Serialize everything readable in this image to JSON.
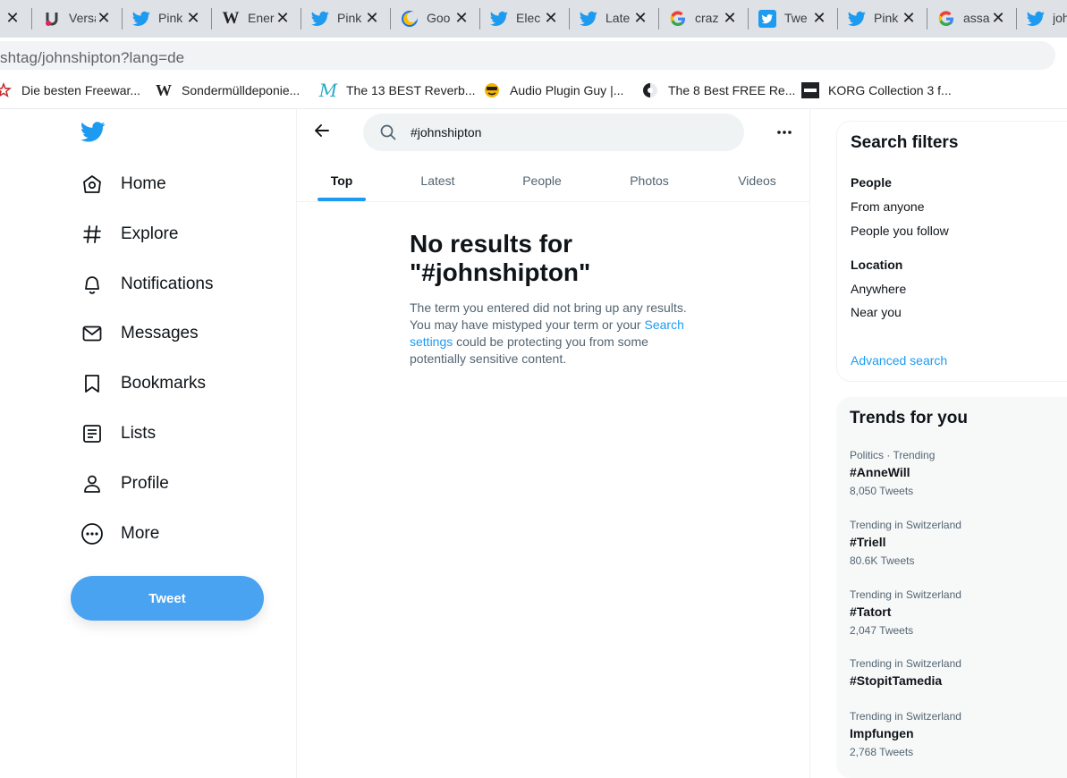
{
  "browser": {
    "tabs": [
      {
        "icon": "close-icon",
        "title": ""
      },
      {
        "icon": "u-logo-icon",
        "title": "Versa"
      },
      {
        "icon": "twitter-bird-icon",
        "title": "Pink"
      },
      {
        "icon": "wikipedia-icon",
        "title": "Ener"
      },
      {
        "icon": "twitter-bird-icon",
        "title": "Pink"
      },
      {
        "icon": "crescent-icon",
        "title": "Goo"
      },
      {
        "icon": "twitter-bird-icon",
        "title": "Elec"
      },
      {
        "icon": "twitter-bird-icon",
        "title": "Late"
      },
      {
        "icon": "google-icon",
        "title": "craz"
      },
      {
        "icon": "twitter-bird-icon",
        "title": "Twe"
      },
      {
        "icon": "twitter-bird-icon",
        "title": "Pink"
      },
      {
        "icon": "google-icon",
        "title": "assa"
      },
      {
        "icon": "twitter-bird-icon",
        "title": "joh"
      }
    ],
    "url": "shtag/johnshipton?lang=de",
    "bookmarks": [
      {
        "icon": "star-icon",
        "label": "Die besten Freewar..."
      },
      {
        "icon": "wikipedia-icon",
        "label": "Sondermülldeponie..."
      },
      {
        "icon": "script-m-icon",
        "label": "The 13 BEST Reverb..."
      },
      {
        "icon": "smiley-icon",
        "label": "Audio Plugin Guy |..."
      },
      {
        "icon": "dial-icon",
        "label": "The 8 Best FREE Re..."
      },
      {
        "icon": "korg-icon",
        "label": "KORG Collection 3 f..."
      }
    ]
  },
  "nav": {
    "items": [
      {
        "icon": "home-icon",
        "label": "Home"
      },
      {
        "icon": "hashtag-icon",
        "label": "Explore"
      },
      {
        "icon": "bell-icon",
        "label": "Notifications"
      },
      {
        "icon": "envelope-icon",
        "label": "Messages"
      },
      {
        "icon": "bookmark-icon",
        "label": "Bookmarks"
      },
      {
        "icon": "list-icon",
        "label": "Lists"
      },
      {
        "icon": "person-icon",
        "label": "Profile"
      },
      {
        "icon": "more-circle-icon",
        "label": "More"
      }
    ],
    "tweet_label": "Tweet"
  },
  "search": {
    "query": "#johnshipton",
    "tabs": [
      "Top",
      "Latest",
      "People",
      "Photos",
      "Videos"
    ],
    "active_tab": "Top",
    "noresults_title": "No results for \"#johnshipton\"",
    "noresults_text_1": "The term you entered did not bring up any results. You may have mistyped your term or your ",
    "noresults_link": "Search settings",
    "noresults_text_2": " could be protecting you from some potentially sensitive content."
  },
  "filters": {
    "title": "Search filters",
    "people_heading": "People",
    "people_options": [
      "From anyone",
      "People you follow"
    ],
    "location_heading": "Location",
    "location_options": [
      "Anywhere",
      "Near you"
    ],
    "advanced_label": "Advanced search"
  },
  "trends": {
    "title": "Trends for you",
    "items": [
      {
        "context": "Politics · Trending",
        "name": "#AnneWill",
        "count": "8,050 Tweets"
      },
      {
        "context": "Trending in Switzerland",
        "name": "#Triell",
        "count": "80.6K Tweets"
      },
      {
        "context": "Trending in Switzerland",
        "name": "#Tatort",
        "count": "2,047 Tweets"
      },
      {
        "context": "Trending in Switzerland",
        "name": "#StopitTamedia",
        "count": ""
      },
      {
        "context": "Trending in Switzerland",
        "name": "Impfungen",
        "count": "2,768 Tweets"
      }
    ]
  },
  "colors": {
    "twitter_blue": "#1d9bf0",
    "tweet_button": "#4aa3f0",
    "text_primary": "#0f1419",
    "text_secondary": "#536471"
  }
}
